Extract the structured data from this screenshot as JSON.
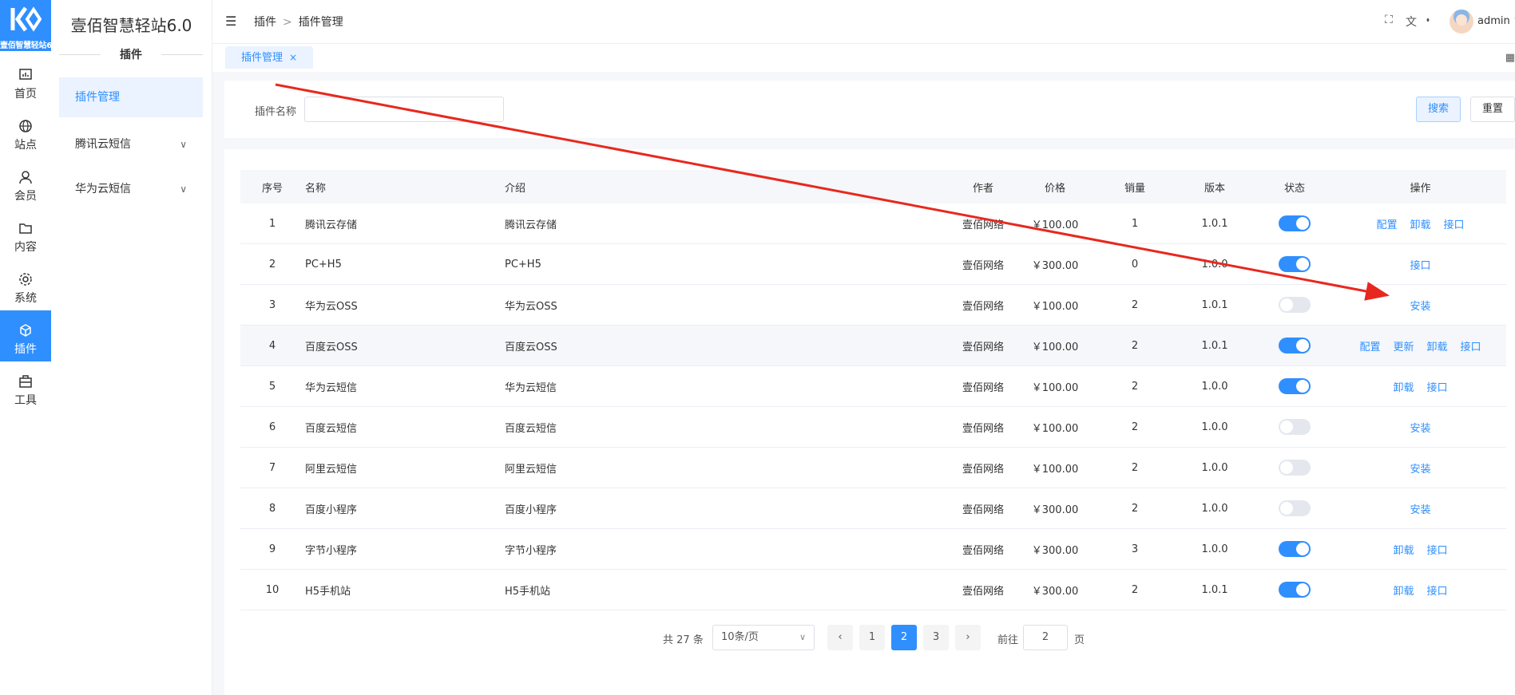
{
  "logo": {
    "text": "壹佰智慧轻站6.0"
  },
  "rail": [
    {
      "label": "首页",
      "icon": "chart-icon"
    },
    {
      "label": "站点",
      "icon": "globe-icon"
    },
    {
      "label": "会员",
      "icon": "user-icon"
    },
    {
      "label": "内容",
      "icon": "folder-icon"
    },
    {
      "label": "系统",
      "icon": "gear-icon"
    },
    {
      "label": "插件",
      "icon": "cube-icon",
      "active": true
    },
    {
      "label": "工具",
      "icon": "toolbox-icon"
    }
  ],
  "sidebar": {
    "brand": "壹佰智慧轻站6.0",
    "section": "插件",
    "items": [
      {
        "label": "插件管理",
        "active": true
      },
      {
        "label": "腾讯云短信"
      },
      {
        "label": "华为云短信"
      }
    ]
  },
  "header": {
    "breadcrumb": [
      "插件",
      "插件管理"
    ],
    "breadcrumb_sep": ">",
    "user": "admin"
  },
  "tabs": [
    {
      "label": "插件管理",
      "close": "×"
    }
  ],
  "search": {
    "label": "插件名称",
    "value": "",
    "search_button": "搜索",
    "reset_button": "重置"
  },
  "table": {
    "columns": [
      "序号",
      "名称",
      "介绍",
      "作者",
      "价格",
      "销量",
      "版本",
      "状态",
      "操作"
    ],
    "rows": [
      {
        "no": "1",
        "name": "腾讯云存储",
        "intro": "腾讯云存储",
        "author": "壹佰网络",
        "price": "￥100.00",
        "sales": "1",
        "version": "1.0.1",
        "on": true,
        "ops": [
          "配置",
          "卸载",
          "接口"
        ]
      },
      {
        "no": "2",
        "name": "PC+H5",
        "intro": "PC+H5",
        "author": "壹佰网络",
        "price": "￥300.00",
        "sales": "0",
        "version": "1.0.0",
        "on": true,
        "ops": [
          "接口"
        ]
      },
      {
        "no": "3",
        "name": "华为云OSS",
        "intro": "华为云OSS",
        "author": "壹佰网络",
        "price": "￥100.00",
        "sales": "2",
        "version": "1.0.1",
        "on": false,
        "ops": [
          "安装"
        ]
      },
      {
        "no": "4",
        "name": "百度云OSS",
        "intro": "百度云OSS",
        "author": "壹佰网络",
        "price": "￥100.00",
        "sales": "2",
        "version": "1.0.1",
        "on": true,
        "ops": [
          "配置",
          "更新",
          "卸载",
          "接口"
        ]
      },
      {
        "no": "5",
        "name": "华为云短信",
        "intro": "华为云短信",
        "author": "壹佰网络",
        "price": "￥100.00",
        "sales": "2",
        "version": "1.0.0",
        "on": true,
        "ops": [
          "卸载",
          "接口"
        ]
      },
      {
        "no": "6",
        "name": "百度云短信",
        "intro": "百度云短信",
        "author": "壹佰网络",
        "price": "￥100.00",
        "sales": "2",
        "version": "1.0.0",
        "on": false,
        "ops": [
          "安装"
        ]
      },
      {
        "no": "7",
        "name": "阿里云短信",
        "intro": "阿里云短信",
        "author": "壹佰网络",
        "price": "￥100.00",
        "sales": "2",
        "version": "1.0.0",
        "on": false,
        "ops": [
          "安装"
        ]
      },
      {
        "no": "8",
        "name": "百度小程序",
        "intro": "百度小程序",
        "author": "壹佰网络",
        "price": "￥300.00",
        "sales": "2",
        "version": "1.0.0",
        "on": false,
        "ops": [
          "安装"
        ]
      },
      {
        "no": "9",
        "name": "字节小程序",
        "intro": "字节小程序",
        "author": "壹佰网络",
        "price": "￥300.00",
        "sales": "3",
        "version": "1.0.0",
        "on": true,
        "ops": [
          "卸载",
          "接口"
        ]
      },
      {
        "no": "10",
        "name": "H5手机站",
        "intro": "H5手机站",
        "author": "壹佰网络",
        "price": "￥300.00",
        "sales": "2",
        "version": "1.0.1",
        "on": true,
        "ops": [
          "卸载",
          "接口"
        ]
      }
    ]
  },
  "pagination": {
    "total": "共 27 条",
    "page_size": "10条/页",
    "pages": [
      "1",
      "2",
      "3"
    ],
    "current": "2",
    "goto_label": "前往",
    "goto_value": "2",
    "page_suffix": "页"
  },
  "colors": {
    "accent": "#2f8fff",
    "annotation_arrow": "#e8281e"
  }
}
